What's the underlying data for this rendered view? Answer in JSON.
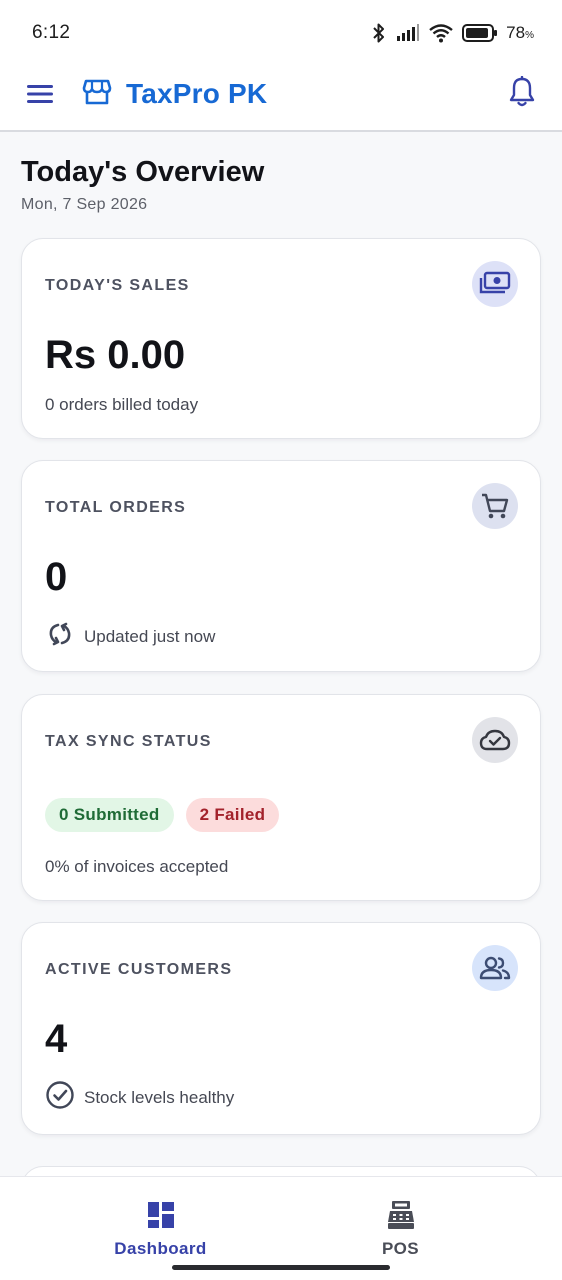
{
  "status_bar": {
    "time": "6:12",
    "battery_percent": "78",
    "battery_suffix": "%"
  },
  "app_bar": {
    "title": "TaxPro PK",
    "brand_color": "#1769d4",
    "icons": {
      "menu": "menu-icon",
      "logo": "store-icon",
      "notifications": "bell-icon"
    }
  },
  "overview": {
    "title": "Today's Overview",
    "date": "Mon, 7 Sep 2026"
  },
  "cards": {
    "sales": {
      "label": "TODAY'S SALES",
      "value": "Rs 0.00",
      "sub": "0 orders billed today",
      "icon": "money-icon"
    },
    "orders": {
      "label": "TOTAL ORDERS",
      "value": "0",
      "sub": "Updated just now",
      "icon": "cart-icon",
      "sub_icon": "refresh-icon"
    },
    "tax_sync": {
      "label": "TAX SYNC STATUS",
      "submitted_chip": "0 Submitted",
      "failed_chip": "2 Failed",
      "sub": "0% of invoices accepted",
      "icon": "cloud-check-icon"
    },
    "customers": {
      "label": "ACTIVE CUSTOMERS",
      "value": "4",
      "sub": "Stock levels healthy",
      "icon": "people-icon",
      "sub_icon": "check-circle-icon"
    }
  },
  "bottom_nav": {
    "items": [
      {
        "label": "Dashboard",
        "icon": "dashboard-icon",
        "active": true
      },
      {
        "label": "POS",
        "icon": "cash-register-icon",
        "active": false
      }
    ]
  },
  "colors": {
    "accent": "#3742a8",
    "success_bg": "#e2f6e6",
    "success_text": "#1f6b36",
    "fail_bg": "#fcdcdc",
    "fail_text": "#a3222b"
  }
}
